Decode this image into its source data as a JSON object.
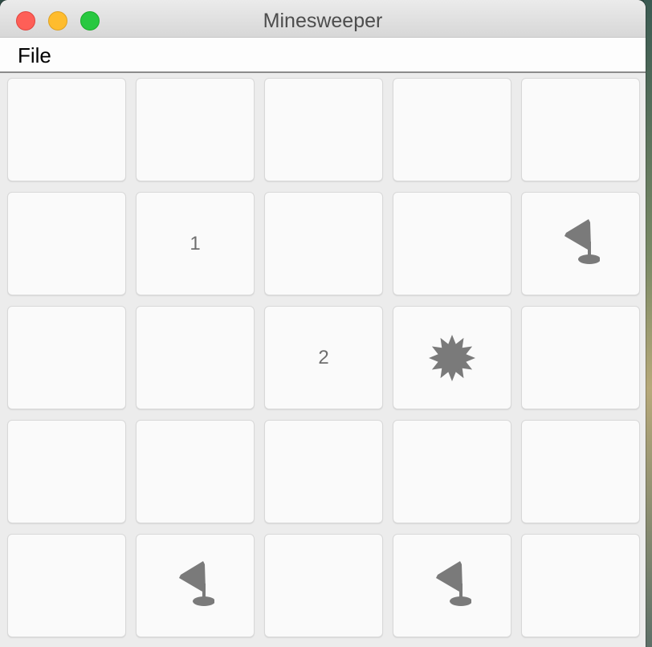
{
  "window": {
    "title": "Minesweeper"
  },
  "menubar": {
    "items": [
      {
        "label": "File"
      }
    ]
  },
  "board": {
    "rows": 5,
    "cols": 5,
    "cells": [
      [
        {
          "state": "covered",
          "text": ""
        },
        {
          "state": "covered",
          "text": ""
        },
        {
          "state": "covered",
          "text": ""
        },
        {
          "state": "covered",
          "text": ""
        },
        {
          "state": "covered",
          "text": ""
        }
      ],
      [
        {
          "state": "covered",
          "text": ""
        },
        {
          "state": "number",
          "text": "1"
        },
        {
          "state": "covered",
          "text": ""
        },
        {
          "state": "covered",
          "text": ""
        },
        {
          "state": "flag",
          "text": "",
          "icon": "flag-icon"
        }
      ],
      [
        {
          "state": "covered",
          "text": ""
        },
        {
          "state": "covered",
          "text": ""
        },
        {
          "state": "number",
          "text": "2"
        },
        {
          "state": "mine",
          "text": "",
          "icon": "mine-icon"
        },
        {
          "state": "covered",
          "text": ""
        }
      ],
      [
        {
          "state": "covered",
          "text": ""
        },
        {
          "state": "covered",
          "text": ""
        },
        {
          "state": "covered",
          "text": ""
        },
        {
          "state": "covered",
          "text": ""
        },
        {
          "state": "covered",
          "text": ""
        }
      ],
      [
        {
          "state": "covered",
          "text": ""
        },
        {
          "state": "flag",
          "text": "",
          "icon": "flag-icon"
        },
        {
          "state": "covered",
          "text": ""
        },
        {
          "state": "flag",
          "text": "",
          "icon": "flag-icon"
        },
        {
          "state": "covered",
          "text": ""
        }
      ]
    ]
  },
  "colors": {
    "number_text": "#6e6e6e",
    "icon_gray": "#7a7a7a"
  }
}
